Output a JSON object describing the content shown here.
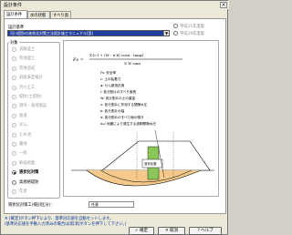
{
  "window": {
    "title": "設計条件",
    "close_glyph": "×"
  },
  "tabs": [
    {
      "label": "設計条件"
    },
    {
      "label": "水の状態"
    },
    {
      "label": "すべり面"
    }
  ],
  "design_standard": {
    "label": "設計基準",
    "selected": "河川堤防の液状化対策工法設計施工マニュアル(案)",
    "radio_right": [
      {
        "label": "平成11年度版",
        "checked": false
      },
      {
        "label": "平成19年度版",
        "checked": false
      }
    ]
  },
  "target_group": {
    "label": "対象",
    "options": [
      {
        "label": "道路盛土",
        "checked": false,
        "disabled": true
      },
      {
        "label": "宅地盛土",
        "checked": false,
        "disabled": true
      },
      {
        "label": "宅地造成",
        "checked": false,
        "disabled": true
      },
      {
        "label": "斜面安定検討",
        "checked": false,
        "disabled": true
      },
      {
        "label": "河川土工",
        "checked": false,
        "disabled": true
      },
      {
        "label": "堤防(土堤防)",
        "checked": false,
        "disabled": true
      },
      {
        "label": "港湾・漁港施設",
        "checked": false,
        "disabled": true
      },
      {
        "label": "鉄道",
        "checked": false,
        "disabled": true
      },
      {
        "label": "ダム",
        "checked": false,
        "disabled": true
      },
      {
        "label": "ため池",
        "checked": false,
        "disabled": true
      },
      {
        "label": "農地",
        "checked": false,
        "disabled": true
      },
      {
        "label": "一般",
        "checked": false,
        "disabled": true
      },
      {
        "label": "軟弱地盤",
        "checked": false,
        "disabled": true
      },
      {
        "label": "液状化対策",
        "checked": true,
        "disabled": false
      },
      {
        "label": "高規格堤防",
        "checked": false,
        "disabled": false
      },
      {
        "label": "任意",
        "checked": false,
        "disabled": true
      }
    ]
  },
  "formula": {
    "lhs": "Fs =",
    "numerator": "Σ{c·l + (W - u·b) cosα · tanφ}",
    "denominator": "Σ W sinα",
    "legend": [
      "Fs: 安全率",
      "c: 土の粘着力",
      "φ: せん断抵抗角",
      "l: 各分割片のすべり面長",
      "W: 各分割片の土の重量",
      "u: 各分割片に作用する間隙水圧",
      "b: 各分割片の幅",
      "α: 各分割片のすべり面の傾き",
      "Δu: 地震により発生する過剰間隙水圧"
    ]
  },
  "diagram": {
    "label1": "液状化層",
    "label2": "非液状化層"
  },
  "misc_row": {
    "label": "液状化対策工(検討区分):",
    "value": "任意"
  },
  "notes": [
    "※ [確定]ボタン押下により、基準対応値を自動セットします。",
    "(基準対応値を手動入力済みの場合は[取消]ボタンを押下して下さい。)"
  ],
  "buttons": {
    "ok": "✓ 確定",
    "cancel": "✕ 取消",
    "help": "? ヘルプ"
  }
}
